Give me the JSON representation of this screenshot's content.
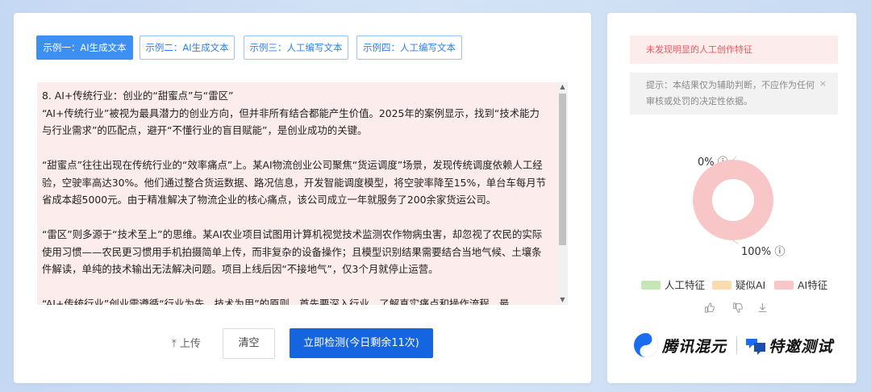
{
  "tabs": [
    {
      "label": "示例一：AI生成文本",
      "active": true
    },
    {
      "label": "示例二：AI生成文本",
      "active": false
    },
    {
      "label": "示例三：人工编写文本",
      "active": false
    },
    {
      "label": "示例四：人工编写文本",
      "active": false
    }
  ],
  "text": {
    "lines": [
      "8. AI+传统行业：创业的“甜蜜点”与“雷区”",
      "“AI+传统行业”被视为最具潜力的创业方向，但并非所有结合都能产生价值。2025年的案例显示，找到“技术能力与行业需求”的匹配点，避开“不懂行业的盲目赋能”，是创业成功的关键。",
      "",
      "“甜蜜点”往往出现在传统行业的“效率痛点”上。某AI物流创业公司聚焦“货运调度”场景，发现传统调度依赖人工经验，空驶率高达30%。他们通过整合货运数据、路况信息，开发智能调度模型，将空驶率降至15%，单台车每月节省成本超5000元。由于精准解决了物流企业的核心痛点，该公司成立一年就服务了200余家货运公司。",
      "",
      "“雷区”则多源于“技术至上”的思维。某AI农业项目试图用计算机视觉技术监测农作物病虫害，却忽视了农民的实际使用习惯——农民更习惯用手机拍摄简单上传，而非复杂的设备操作；且模型识别结果需要结合当地气候、土壤条件解读，单纯的技术输出无法解决问题。项目上线后因“不接地气”，仅3个月就停止运营。",
      "",
      "“AI+传统行业”创业需遵循“行业为先，技术为用”的原则。首先要深入行业，了解真实痛点和操作流程，最"
    ]
  },
  "actions": {
    "upload_label": "上传",
    "clear_label": "清空",
    "detect_label": "立即检测(今日剩余11次)"
  },
  "result": {
    "alert": "未发现明显的人工创作特征",
    "hint": "提示：本结果仅为辅助判断，不应作为任何审核或处罚的决定性依据。",
    "close_icon": "×",
    "pct_top": "0%",
    "pct_bottom": "100%",
    "info_icon": "ⓘ",
    "legend": [
      {
        "label": "人工特征",
        "color": "#c6e6b8"
      },
      {
        "label": "疑似AI",
        "color": "#f9dcb0"
      },
      {
        "label": "AI特征",
        "color": "#f8c6c6"
      }
    ],
    "ai_fraction": 1.0,
    "donut_color": "#f8c6c6"
  },
  "brand": {
    "name": "腾讯混元",
    "tag": "特邀测试"
  }
}
